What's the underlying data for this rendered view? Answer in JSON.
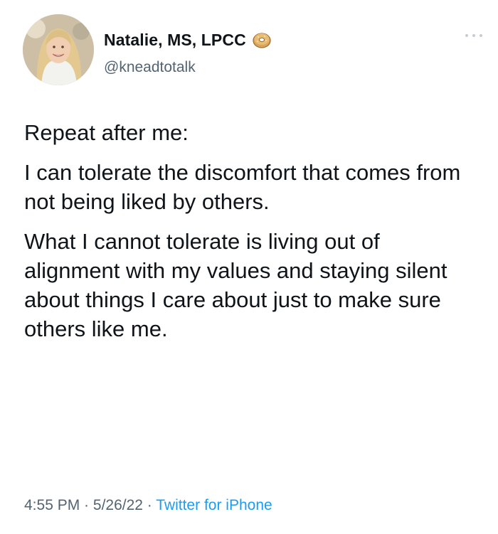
{
  "author": {
    "display_name": "Natalie, MS, LPCC",
    "handle": "@kneadtotalk",
    "badge_icon": "bagel-emoji-icon",
    "avatar_icon": "profile-photo"
  },
  "tweet": {
    "paragraphs": [
      "Repeat after me:",
      "I can tolerate the discomfort that comes from not being liked by others.",
      "What I cannot tolerate is living out of alignment with my values and staying silent about things I care about just to make sure others like me."
    ]
  },
  "meta": {
    "time": "4:55 PM",
    "separator": " · ",
    "date": "5/26/22",
    "source": "Twitter for iPhone"
  },
  "colors": {
    "text": "#0f1419",
    "muted": "#536471",
    "link": "#1d9bf0"
  }
}
